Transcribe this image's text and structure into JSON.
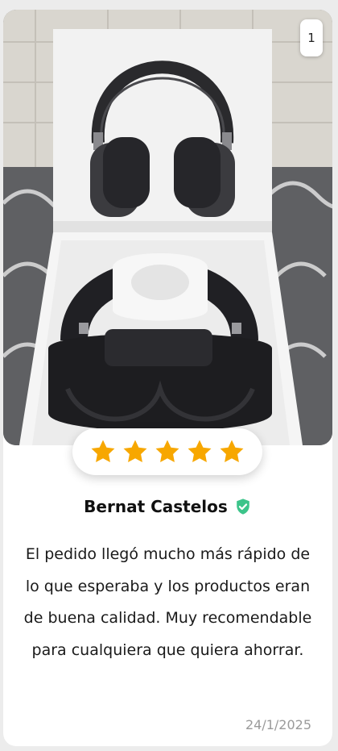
{
  "carousel": {
    "page_indicator": "1"
  },
  "rating": {
    "stars": 5,
    "max": 5,
    "star_color": "#f7a700"
  },
  "review": {
    "author": "Bernat Castelos",
    "verified": true,
    "verified_color": "#3cc48a",
    "text": "El pedido llegó mucho más rápido de lo que esperaba y los productos eran de buena calidad. Muy recomendable para cualquiera que quiera ahorrar.",
    "date": "24/1/2025"
  },
  "photo": {
    "subject": "headphones-in-box"
  }
}
